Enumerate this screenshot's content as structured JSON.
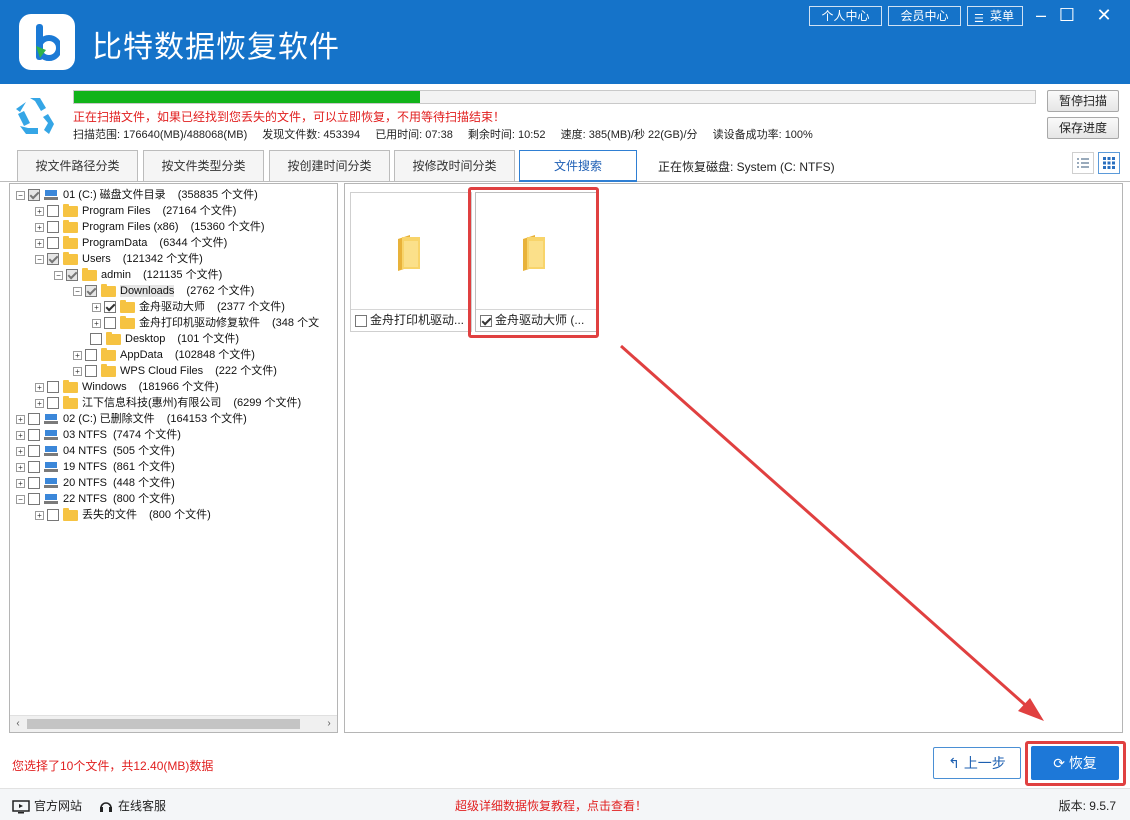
{
  "app": {
    "title": "比特数据恢复软件",
    "top_buttons": [
      "个人中心",
      "会员中心",
      "菜单"
    ]
  },
  "scan": {
    "progress_percent": 36,
    "message": "正在扫描文件，如果已经找到您丢失的文件，可以立即恢复，不用等待扫描结束！",
    "stats": {
      "range": "扫描范围: 176640(MB)/488068(MB)",
      "found": "发现文件数: 453394",
      "elapsed": "已用时间: 07:38",
      "remaining": "剩余时间: 10:52",
      "speed": "速度: 385(MB)/秒 22(GB)/分",
      "success_rate": "读设备成功率: 100%"
    },
    "pause_label": "暂停扫描",
    "save_label": "保存进度"
  },
  "tabs": {
    "items": [
      "按文件路径分类",
      "按文件类型分类",
      "按创建时间分类",
      "按修改时间分类",
      "文件搜索"
    ],
    "active_index": 4,
    "recovering_text": "正在恢复磁盘: System (C: NTFS)"
  },
  "tree": {
    "rows": [
      {
        "label": "01 (C:) 磁盘文件目录",
        "count": "(358835 个文件)"
      },
      {
        "label": "Program Files",
        "count": "(27164 个文件)"
      },
      {
        "label": "Program Files (x86)",
        "count": "(15360 个文件)"
      },
      {
        "label": "ProgramData",
        "count": "(6344 个文件)"
      },
      {
        "label": "Users",
        "count": "(121342 个文件)"
      },
      {
        "label": "admin",
        "count": "(121135 个文件)"
      },
      {
        "label": "Downloads",
        "count": "(2762 个文件)"
      },
      {
        "label": "金舟驱动大师",
        "count": "(2377 个文件)"
      },
      {
        "label": "金舟打印机驱动修复软件",
        "count": "(348 个文"
      },
      {
        "label": "Desktop",
        "count": "(101 个文件)"
      },
      {
        "label": "AppData",
        "count": "(102848 个文件)"
      },
      {
        "label": "WPS Cloud Files",
        "count": "(222 个文件)"
      },
      {
        "label": "Windows",
        "count": "(181966 个文件)"
      },
      {
        "label": "江下信息科技(惠州)有限公司",
        "count": "(6299 个文件)"
      },
      {
        "label": "02 (C:) 已删除文件",
        "count": "(164153 个文件)"
      },
      {
        "label": "03  NTFS",
        "count": "(7474 个文件)"
      },
      {
        "label": "04  NTFS",
        "count": "(505 个文件)"
      },
      {
        "label": "19  NTFS",
        "count": "(861 个文件)"
      },
      {
        "label": "20  NTFS",
        "count": "(448 个文件)"
      },
      {
        "label": "22  NTFS",
        "count": "(800 个文件)"
      },
      {
        "label": "丢失的文件",
        "count": "(800 个文件)"
      }
    ]
  },
  "files": {
    "items": [
      {
        "name": "金舟打印机驱动...",
        "checked": false
      },
      {
        "name": "金舟驱动大师 (...",
        "checked": true
      }
    ]
  },
  "bottom": {
    "selection_info": "您选择了10个文件，共12.40(MB)数据",
    "prev_label": "上一步",
    "recover_label": "恢复"
  },
  "footer": {
    "website": "官方网站",
    "support": "在线客服",
    "tutorial": "超级详细数据恢复教程，点击查看！",
    "version": "版本: 9.5.7"
  },
  "colors": {
    "titlebar": "#1573c9",
    "progress": "#11b31a",
    "alert": "#e11f1f",
    "highlight_box": "#e04040",
    "primary_button": "#1d78d8"
  }
}
